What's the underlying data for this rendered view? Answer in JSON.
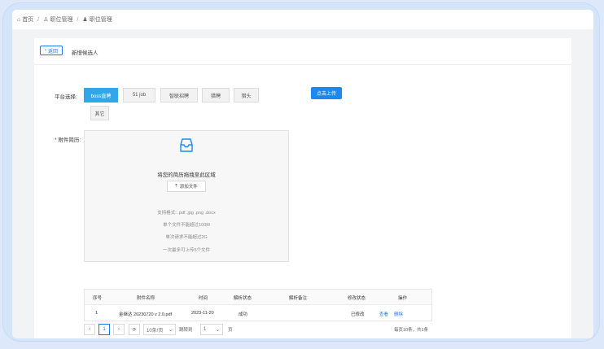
{
  "breadcrumb": {
    "home": "首页",
    "sep": "/",
    "mid": "职位管理",
    "current": "职位管理"
  },
  "topbar": {
    "back": "返回",
    "title": "新增候选人"
  },
  "form": {
    "platform_label": "平台选择:",
    "platforms": [
      "boss直聘",
      "51 job",
      "智联招聘",
      "猎聘",
      "猎头",
      "其它"
    ],
    "active_platform": "boss直聘",
    "upload_button": "点击上传",
    "attachment_label": "附件简历:",
    "required_mark": "*"
  },
  "dropzone": {
    "title": "将您的简历拖拽至此区域",
    "add_file": "添加文件",
    "hints": [
      "支持格式: .pdf .jpg .png .docx",
      "单个文件不能超过100M",
      "单次请求不能超过2G",
      "一次最多可上传5个文件"
    ]
  },
  "table": {
    "headers": [
      "序号",
      "附件名称",
      "时间",
      "解析状态",
      "解析备注",
      "修改状态",
      "操作"
    ],
    "rows": [
      {
        "index": "1",
        "name": "金继达 20230720 v 2.0.pdf",
        "time": "2023-11-20",
        "parse_status": "成功",
        "remark": "",
        "modify_status": "已修改",
        "view": "查看",
        "delete": "删除"
      }
    ]
  },
  "pager": {
    "prev": "‹",
    "current_page": "1",
    "next": "›",
    "refresh": "⟳",
    "page_size": "10条/页",
    "goto_label": "跳转到",
    "goto_value": "1",
    "page_unit": "页",
    "summary": "每页10条，共1条"
  },
  "colors": {
    "primary": "#1e78e6",
    "active_platform": "#2fa7ea",
    "required": "#e0262f"
  }
}
